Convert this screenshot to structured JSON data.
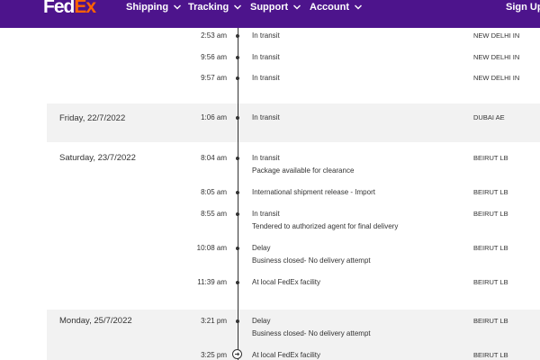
{
  "brand": {
    "fed": "Fed",
    "ex": "Ex"
  },
  "nav": {
    "items": [
      {
        "label": "Shipping"
      },
      {
        "label": "Tracking"
      },
      {
        "label": "Support"
      },
      {
        "label": "Account"
      }
    ],
    "signup_label": "Sign Up/L"
  },
  "colors": {
    "brand_purple": "#4d148c",
    "brand_orange": "#ff6200",
    "band_gray": "#f2f2f2"
  },
  "days": [
    {
      "label": "Friday, 22/7/2022"
    },
    {
      "label": "Saturday, 23/7/2022"
    },
    {
      "label": "Monday, 25/7/2022"
    }
  ],
  "events": [
    {
      "time": "2:53 am",
      "status": "In transit",
      "detail": "",
      "location": "NEW DELHI IN"
    },
    {
      "time": "9:56 am",
      "status": "In transit",
      "detail": "",
      "location": "NEW DELHI IN"
    },
    {
      "time": "9:57 am",
      "status": "In transit",
      "detail": "",
      "location": "NEW DELHI IN"
    },
    {
      "time": "1:06 am",
      "status": "In transit",
      "detail": "",
      "location": "DUBAI AE"
    },
    {
      "time": "8:04 am",
      "status": "In transit",
      "detail": "Package available for clearance",
      "location": "BEIRUT LB"
    },
    {
      "time": "8:05 am",
      "status": "International shipment release - Import",
      "detail": "",
      "location": "BEIRUT LB"
    },
    {
      "time": "8:55 am",
      "status": "In transit",
      "detail": "Tendered to authorized agent for final delivery",
      "location": "BEIRUT LB"
    },
    {
      "time": "10:08 am",
      "status": "Delay",
      "detail": "Business closed- No delivery attempt",
      "location": "BEIRUT LB"
    },
    {
      "time": "11:39 am",
      "status": "At local FedEx facility",
      "detail": "",
      "location": "BEIRUT LB"
    },
    {
      "time": "3:21 pm",
      "status": "Delay",
      "detail": "Business closed- No delivery attempt",
      "location": "BEIRUT LB"
    },
    {
      "time": "3:25 pm",
      "status": "At local FedEx facility",
      "detail": "",
      "location": "BEIRUT LB"
    }
  ],
  "icons": {
    "chevron": "chevron-down-icon",
    "arrow": "arrow-right-circle-icon"
  }
}
